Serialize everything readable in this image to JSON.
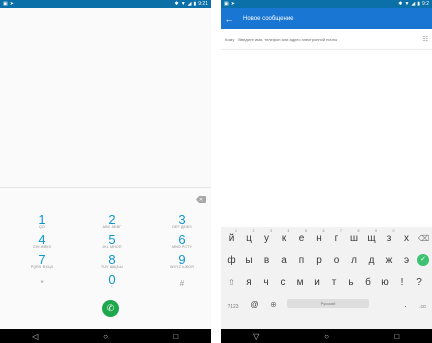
{
  "left_screen": {
    "status": {
      "time": "9:21",
      "left_icons": [
        "image-icon",
        "send-icon"
      ],
      "right_icons": [
        "bluetooth-icon",
        "wifi-icon",
        "signal-icon",
        "battery-icon"
      ]
    },
    "keypad": [
      {
        "digit": "1",
        "letters": "QO"
      },
      {
        "digit": "2",
        "letters": "ABC\nАБВГ"
      },
      {
        "digit": "3",
        "letters": "DEF\nДЕЖЗ"
      },
      {
        "digit": "4",
        "letters": "GHI\nИЙКЛ"
      },
      {
        "digit": "5",
        "letters": "JKL\nМНОП"
      },
      {
        "digit": "6",
        "letters": "MNO\nРСТУ"
      },
      {
        "digit": "7",
        "letters": "PQRS\nФХЦЧ"
      },
      {
        "digit": "8",
        "letters": "TUV\nШЩЪЫ"
      },
      {
        "digit": "9",
        "letters": "WXYZ\nЬЭЮЯ"
      },
      {
        "digit": "*",
        "letters": ""
      },
      {
        "digit": "0",
        "letters": "+"
      },
      {
        "digit": "#",
        "letters": ""
      }
    ],
    "call_icon": "phone-icon",
    "nav": [
      "back-icon",
      "home-icon",
      "recents-icon"
    ]
  },
  "right_screen": {
    "status": {
      "time": "9:2",
      "left_icons": [
        "image-icon",
        "send-icon"
      ],
      "right_icons": [
        "bluetooth-icon",
        "wifi-icon",
        "signal-icon",
        "battery-icon"
      ]
    },
    "appbar": {
      "title": "Новое сообщение",
      "back_icon": "arrow-back-icon"
    },
    "to_row": {
      "label": "Кому",
      "placeholder": "Введите имя, телефон или адрес электронной почты"
    },
    "keyboard": {
      "row1": [
        {
          "key": "й",
          "hint": "1"
        },
        {
          "key": "ц",
          "hint": "2"
        },
        {
          "key": "у",
          "hint": "3"
        },
        {
          "key": "к",
          "hint": "4"
        },
        {
          "key": "е",
          "hint": "5"
        },
        {
          "key": "н",
          "hint": "6"
        },
        {
          "key": "г",
          "hint": "7"
        },
        {
          "key": "ш",
          "hint": "8"
        },
        {
          "key": "щ",
          "hint": "9"
        },
        {
          "key": "з",
          "hint": "0"
        },
        {
          "key": "х",
          "hint": ""
        }
      ],
      "row2": [
        "ф",
        "ы",
        "в",
        "а",
        "п",
        "р",
        "о",
        "л",
        "д",
        "ж",
        "э"
      ],
      "row3": [
        "я",
        "ч",
        "с",
        "м",
        "и",
        "т",
        "ь",
        "б",
        "ю",
        "!",
        "?"
      ],
      "row4": {
        "num_label": "?123",
        "at": "@",
        "space_label": "Русский",
        "period": ".",
        "dotcom": ".co"
      },
      "colors": {
        "enter": "#3ec173",
        "accent": "#1976d2"
      }
    },
    "nav": [
      "back-icon",
      "home-icon",
      "recents-icon"
    ]
  }
}
